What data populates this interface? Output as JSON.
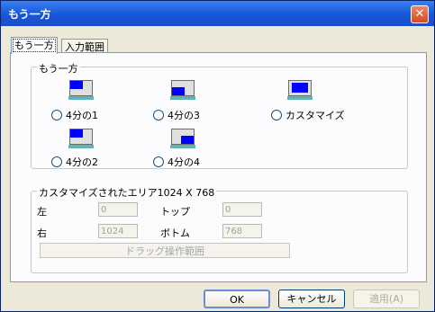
{
  "window": {
    "title": "もう一方",
    "close_label": "✕"
  },
  "tabs": [
    "もう一方",
    "入力範囲"
  ],
  "group1": {
    "label": "もう一方",
    "options": [
      "4分の1",
      "4分の3",
      "カスタマイズ",
      "4分の2",
      "4分の4"
    ]
  },
  "group2": {
    "label": "カスタマイズされたエリア1024 X 768",
    "left_label": "左",
    "left_value": "0",
    "top_label": "トップ",
    "top_value": "0",
    "right_label": "右",
    "right_value": "1024",
    "bottom_label": "ボトム",
    "bottom_value": "768",
    "drag_button": "ドラッグ操作範囲"
  },
  "buttons": {
    "ok": "OK",
    "cancel": "キャンセル",
    "apply": "適用(A)"
  },
  "colors": {
    "titlebar": "#1656d8",
    "screen_blue": "#0000ff",
    "monitor_base": "#5fb4b6"
  }
}
